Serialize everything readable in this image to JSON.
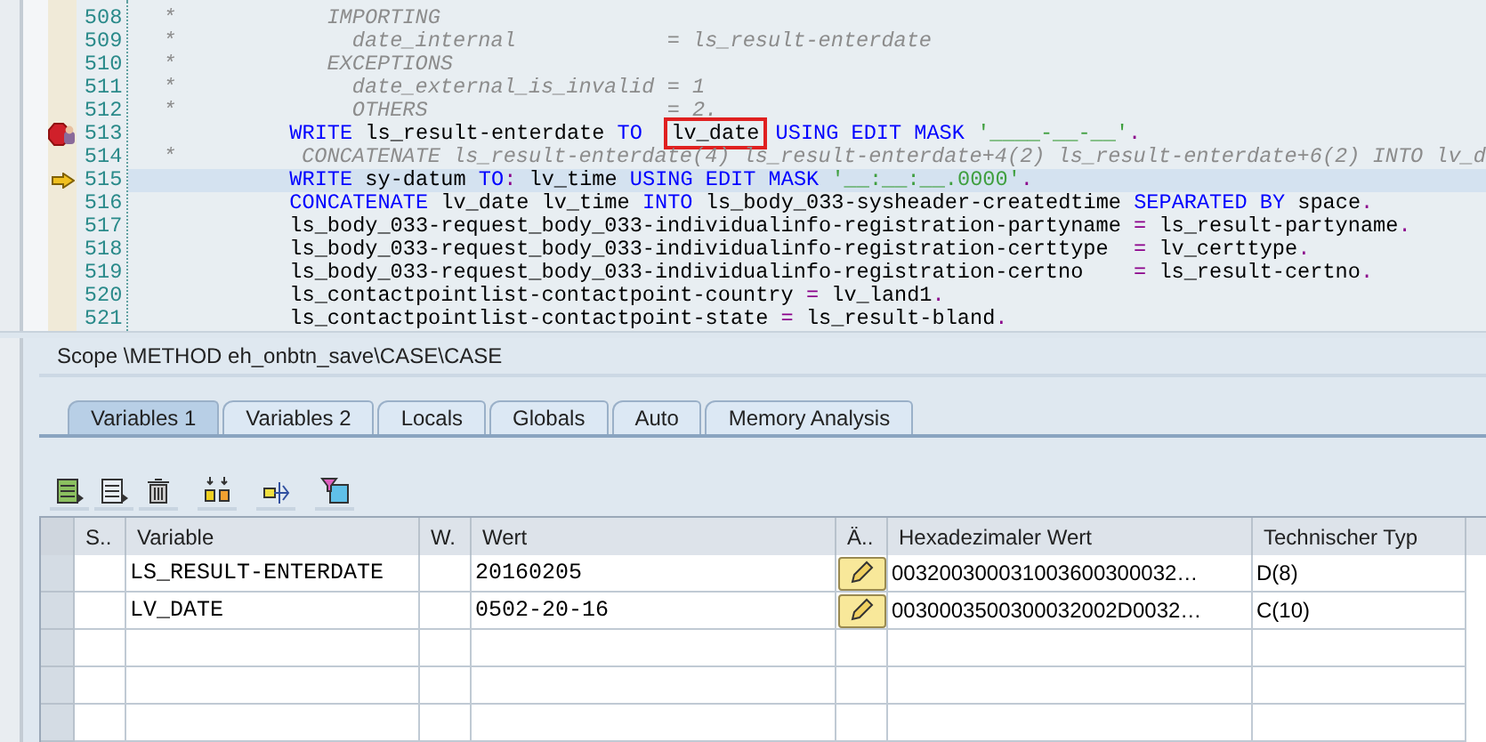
{
  "editor": {
    "lines": [
      {
        "number": "508",
        "breakpoint": false,
        "current": false,
        "tokens": [
          {
            "kind": "comment",
            "text": "*            IMPORTING"
          }
        ]
      },
      {
        "number": "509",
        "breakpoint": false,
        "current": false,
        "tokens": [
          {
            "kind": "comment",
            "text": "*              date_internal            = ls_result-enterdate"
          }
        ]
      },
      {
        "number": "510",
        "breakpoint": false,
        "current": false,
        "tokens": [
          {
            "kind": "comment",
            "text": "*            EXCEPTIONS"
          }
        ]
      },
      {
        "number": "511",
        "breakpoint": false,
        "current": false,
        "tokens": [
          {
            "kind": "comment",
            "text": "*              date_external_is_invalid = 1"
          }
        ]
      },
      {
        "number": "512",
        "breakpoint": false,
        "current": false,
        "tokens": [
          {
            "kind": "comment",
            "text": "*              OTHERS                   = 2."
          }
        ]
      },
      {
        "number": "513",
        "breakpoint": true,
        "current": false,
        "tokens": [
          {
            "kind": "keyword",
            "text": "WRITE"
          },
          {
            "kind": "plain",
            "text": "ls_result-enterdate"
          },
          {
            "kind": "keyword",
            "text": "TO "
          },
          {
            "kind": "boxed",
            "text": "lv_date"
          },
          {
            "kind": "keyword",
            "text": "USING EDIT MASK"
          },
          {
            "kind": "string",
            "text": "'____-__-__'"
          },
          {
            "kind": "punct",
            "text": "."
          }
        ]
      },
      {
        "number": "514",
        "breakpoint": false,
        "current": false,
        "tokens": [
          {
            "kind": "comment",
            "text": "*          CONCATENATE ls_result-enterdate(4) ls_result-enterdate+4(2) ls_result-enterdate+6(2) INTO lv_d"
          }
        ]
      },
      {
        "number": "515",
        "breakpoint": false,
        "current": true,
        "tokens": [
          {
            "kind": "keyword",
            "text": "WRITE"
          },
          {
            "kind": "plain",
            "text": "sy-datum"
          },
          {
            "kind": "keyword",
            "text": "TO"
          },
          {
            "kind": "punct",
            "text": ":"
          },
          {
            "kind": "plain",
            "text": "lv_time"
          },
          {
            "kind": "keyword",
            "text": "USING EDIT MASK"
          },
          {
            "kind": "string",
            "text": "'__:__:__.0000'"
          },
          {
            "kind": "punct",
            "text": "."
          }
        ]
      },
      {
        "number": "516",
        "breakpoint": false,
        "current": false,
        "tokens": [
          {
            "kind": "keyword",
            "text": "CONCATENATE"
          },
          {
            "kind": "plain",
            "text": "lv_date lv_time"
          },
          {
            "kind": "keyword",
            "text": "INTO"
          },
          {
            "kind": "plain",
            "text": "ls_body_033-sysheader-createdtime"
          },
          {
            "kind": "keyword",
            "text": "SEPARATED BY"
          },
          {
            "kind": "plain",
            "text": "space"
          },
          {
            "kind": "punct",
            "text": "."
          }
        ]
      },
      {
        "number": "517",
        "breakpoint": false,
        "current": false,
        "tokens": [
          {
            "kind": "plain",
            "text": "ls_body_033-request_body_033-individualinfo-registration-partyname"
          },
          {
            "kind": "operator",
            "text": "="
          },
          {
            "kind": "plain",
            "text": "ls_result-partyname"
          },
          {
            "kind": "punct",
            "text": "."
          }
        ]
      },
      {
        "number": "518",
        "breakpoint": false,
        "current": false,
        "tokens": [
          {
            "kind": "plain",
            "text": "ls_body_033-request_body_033-individualinfo-registration-certtype "
          },
          {
            "kind": "operator",
            "text": "="
          },
          {
            "kind": "plain",
            "text": "lv_certtype"
          },
          {
            "kind": "punct",
            "text": "."
          }
        ]
      },
      {
        "number": "519",
        "breakpoint": false,
        "current": false,
        "tokens": [
          {
            "kind": "plain",
            "text": "ls_body_033-request_body_033-individualinfo-registration-certno   "
          },
          {
            "kind": "operator",
            "text": "="
          },
          {
            "kind": "plain",
            "text": "ls_result-certno"
          },
          {
            "kind": "punct",
            "text": "."
          }
        ]
      },
      {
        "number": "520",
        "breakpoint": false,
        "current": false,
        "tokens": [
          {
            "kind": "plain",
            "text": "ls_contactpointlist-contactpoint-country"
          },
          {
            "kind": "operator",
            "text": "="
          },
          {
            "kind": "plain",
            "text": "lv_land1"
          },
          {
            "kind": "punct",
            "text": "."
          }
        ]
      },
      {
        "number": "521",
        "breakpoint": false,
        "current": false,
        "tokens": [
          {
            "kind": "plain",
            "text": "ls_contactpointlist-contactpoint-state"
          },
          {
            "kind": "operator",
            "text": "="
          },
          {
            "kind": "plain",
            "text": "ls_result-bland"
          },
          {
            "kind": "punct",
            "text": "."
          }
        ]
      }
    ]
  },
  "scope": "Scope \\METHOD eh_onbtn_save\\CASE\\CASE",
  "tabs": [
    {
      "label": "Variables 1",
      "selected": true
    },
    {
      "label": "Variables 2",
      "selected": false
    },
    {
      "label": "Locals",
      "selected": false
    },
    {
      "label": "Globals",
      "selected": false
    },
    {
      "label": "Auto",
      "selected": false
    },
    {
      "label": "Memory Analysis",
      "selected": false
    }
  ],
  "toolbar": [
    {
      "kind": "table-add"
    },
    {
      "kind": "table-export"
    },
    {
      "kind": "delete"
    },
    {
      "kind": "merge"
    },
    {
      "kind": "transfer"
    },
    {
      "kind": "filter"
    }
  ],
  "table": {
    "columns": [
      "S..",
      "Variable",
      "W.",
      "Wert",
      "Ä..",
      "Hexadezimaler Wert",
      "Technischer Typ"
    ],
    "rows": [
      {
        "variable": "LS_RESULT-ENTERDATE",
        "value": "20160205",
        "hex": "003200300031003600300032…",
        "type": "D(8)"
      },
      {
        "variable": "LV_DATE",
        "value": "0502-20-16",
        "hex": "0030003500300032002D0032…",
        "type": "C(10)"
      }
    ]
  }
}
